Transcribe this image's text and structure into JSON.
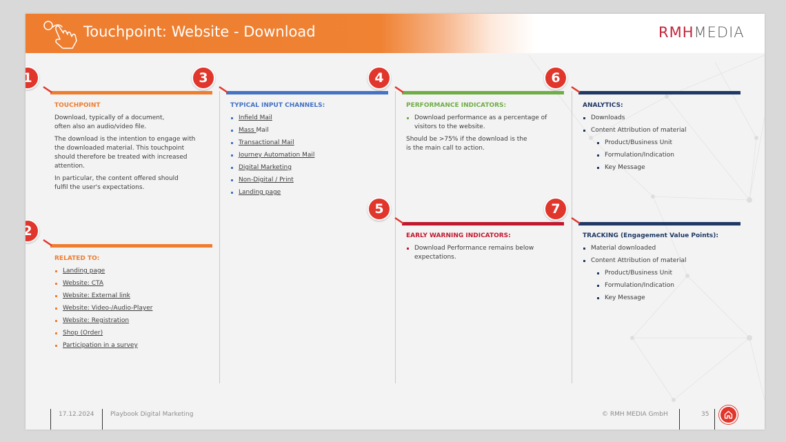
{
  "header": {
    "title": "Touchpoint: Website - Download",
    "logo": {
      "part1": "RMH",
      "part2": "MEDIA"
    }
  },
  "colors": {
    "orange": "#ee7d2f",
    "blue": "#4472c4",
    "green": "#70ad47",
    "navy": "#1f3864",
    "red": "#c0182f",
    "badge": "#e0362b"
  },
  "badges": [
    "1",
    "2",
    "3",
    "4",
    "5",
    "6",
    "7"
  ],
  "touchpoint": {
    "heading": "TOUCHPOINT",
    "paragraphs": [
      "Download, typically of a document,\noften also an audio/video file.",
      "The download is the intention to engage with\nthe downloaded material. This touchpoint\nshould therefore be treated with increased\nattention.",
      "In particular, the content offered should\nfulfil the user's expectations."
    ]
  },
  "related": {
    "heading": "RELATED TO:",
    "items": [
      "Landing page",
      "Website: CTA",
      "Website: External link",
      "Website: Video-/Audio-Player",
      "Website: Registration",
      "Shop (Order)",
      "Participation in a survey"
    ]
  },
  "input_channels": {
    "heading": "TYPICAL INPUT CHANNELS:",
    "items": [
      {
        "text": "Infield Mail",
        "suffix": ""
      },
      {
        "text": "Mass ",
        "suffix": "Mail"
      },
      {
        "text": "Transactional Mail",
        "suffix": ""
      },
      {
        "text": "Journey Automation Mail",
        "suffix": ""
      },
      {
        "text": "Digital Marketing",
        "suffix": ""
      },
      {
        "text": "Non-Digital / Print",
        "suffix": ""
      },
      {
        "text": "Landing page",
        "suffix": ""
      }
    ]
  },
  "performance": {
    "heading": "PERFORMANCE INDICATORS:",
    "item": "Download performance as a percentage of\nvisitors to the website.",
    "note": "Should be >75% if the download is the\nis the main call to action."
  },
  "early_warning": {
    "heading": "EARLY WARNING INDICATORS:",
    "item": "Download Performance remains below\nexpectations."
  },
  "analytics": {
    "heading": "ANALYTICS:",
    "items": [
      "Downloads",
      "Content Attribution of material"
    ],
    "sub_items": [
      "Product/Business Unit",
      "Formulation/Indication",
      "Key Message"
    ]
  },
  "tracking": {
    "heading": "TRACKING (Engagement Value Points):",
    "items": [
      "Material downloaded",
      "Content Attribution of material"
    ],
    "sub_items": [
      "Product/Business Unit",
      "Formulation/Indication",
      "Key Message"
    ]
  },
  "footer": {
    "date": "17.12.2024",
    "doc_title": "Playbook Digital Marketing",
    "copyright": "© RMH MEDIA GmbH",
    "page": "35"
  }
}
